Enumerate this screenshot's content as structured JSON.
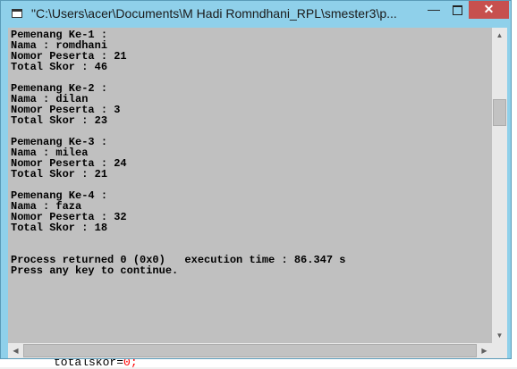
{
  "window": {
    "title": "\"C:\\Users\\acer\\Documents\\M Hadi Romndhani_RPL\\smester3\\p...",
    "minimize": "—",
    "close": "✕"
  },
  "console": {
    "lines": [
      "Pemenang Ke-1 :",
      "Nama : romdhani",
      "Nomor Peserta : 21",
      "Total Skor : 46",
      "",
      "Pemenang Ke-2 :",
      "Nama : dilan",
      "Nomor Peserta : 3",
      "Total Skor : 23",
      "",
      "Pemenang Ke-3 :",
      "Nama : milea",
      "Nomor Peserta : 24",
      "Total Skor : 21",
      "",
      "Pemenang Ke-4 :",
      "Nama : faza",
      "Nomor Peserta : 32",
      "Total Skor : 18",
      "",
      "",
      "Process returned 0 (0x0)   execution time : 86.347 s",
      "Press any key to continue."
    ]
  },
  "background_editor": {
    "line_text": "totalskor=",
    "line_number": "0;"
  },
  "icons": {
    "scroll_up": "▲",
    "scroll_down": "▼",
    "scroll_left": "◀",
    "scroll_right": "▶"
  }
}
